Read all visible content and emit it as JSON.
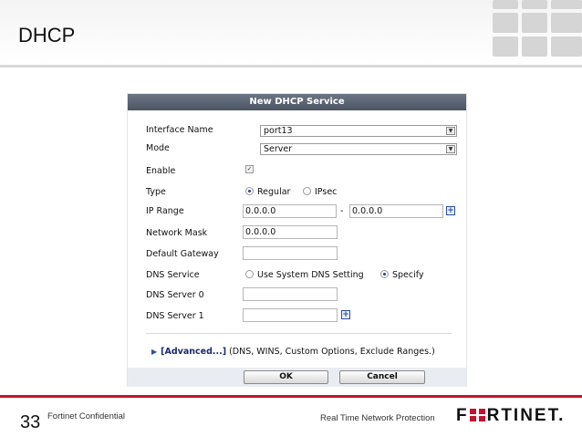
{
  "slide": {
    "title": "DHCP",
    "number": "33",
    "confidential": "Fortinet Confidential",
    "tagline": "Real Time Network Protection",
    "brand_left": "F",
    "brand_right": "RTINET.",
    "accent_color": "#c4122f"
  },
  "dialog": {
    "title": "New DHCP Service",
    "fields": {
      "interface_name": {
        "label": "Interface Name",
        "value": "port13"
      },
      "mode": {
        "label": "Mode",
        "value": "Server"
      },
      "enable": {
        "label": "Enable",
        "checked": true
      },
      "type": {
        "label": "Type",
        "options": [
          "Regular",
          "IPsec"
        ],
        "selected": "Regular"
      },
      "ip_range": {
        "label": "IP Range",
        "start": "0.0.0.0",
        "separator": "-",
        "end": "0.0.0.0"
      },
      "network_mask": {
        "label": "Network Mask",
        "value": "0.0.0.0"
      },
      "default_gateway": {
        "label": "Default Gateway",
        "value": ""
      },
      "dns_service": {
        "label": "DNS Service",
        "options": [
          "Use System DNS Setting",
          "Specify"
        ],
        "selected": "Specify"
      },
      "dns_server_0": {
        "label": "DNS Server 0",
        "value": ""
      },
      "dns_server_1": {
        "label": "DNS Server 1",
        "value": ""
      }
    },
    "advanced": {
      "link": "[Advanced...]",
      "desc": " (DNS, WINS, Custom Options, Exclude Ranges.)"
    },
    "buttons": {
      "ok": "OK",
      "cancel": "Cancel"
    }
  }
}
